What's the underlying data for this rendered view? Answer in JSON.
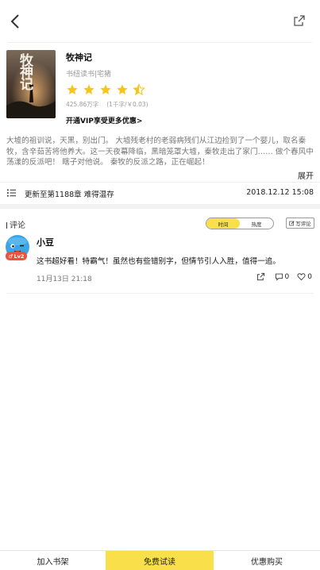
{
  "header": {
    "back_icon": "chevron-left-icon",
    "share_icon": "share-icon"
  },
  "book": {
    "title": "牧神记",
    "meta": "书纽读书|宅猪",
    "rating": 4.5,
    "rating_max": 5,
    "star_color": "#f5c518",
    "word_count": "425.86万字",
    "price": "(1千字/￥0.03)",
    "vip_text": "开通VIP享受更多优惠>",
    "cover_title": "牧神记",
    "description": "大墟的祖训说，天黑，别出门。 大墟残老村的老弱病残们从江边捡到了一个婴儿，取名秦牧，含辛茹苦将他养大。这一天夜幕降临，黑暗笼罩大墟，秦牧走出了家门…… 做个春风中荡漾的反派吧！ 瞎子对他说。 秦牧的反派之路，正在崛起！",
    "expand_label": "展开"
  },
  "chapter": {
    "text": "更新至第1188章 难得温存",
    "time": "2018.12.12 15:08"
  },
  "comments": {
    "section_title": "评论",
    "sort_time": "时间",
    "sort_hot": "热度",
    "write_label": "写评论",
    "items": [
      {
        "username": "小豆",
        "level": "Lv2",
        "text": "这书超好看！特霸气！虽然也有些错别字，但情节引人入胜，值得一追。",
        "date": "11月13日 21:18",
        "reply_count": "0",
        "like_count": "0"
      }
    ]
  },
  "bottom": {
    "add_shelf": "加入书架",
    "free_read": "免费试读",
    "buy": "优惠购买"
  },
  "colors": {
    "accent": "#f9e04b"
  }
}
